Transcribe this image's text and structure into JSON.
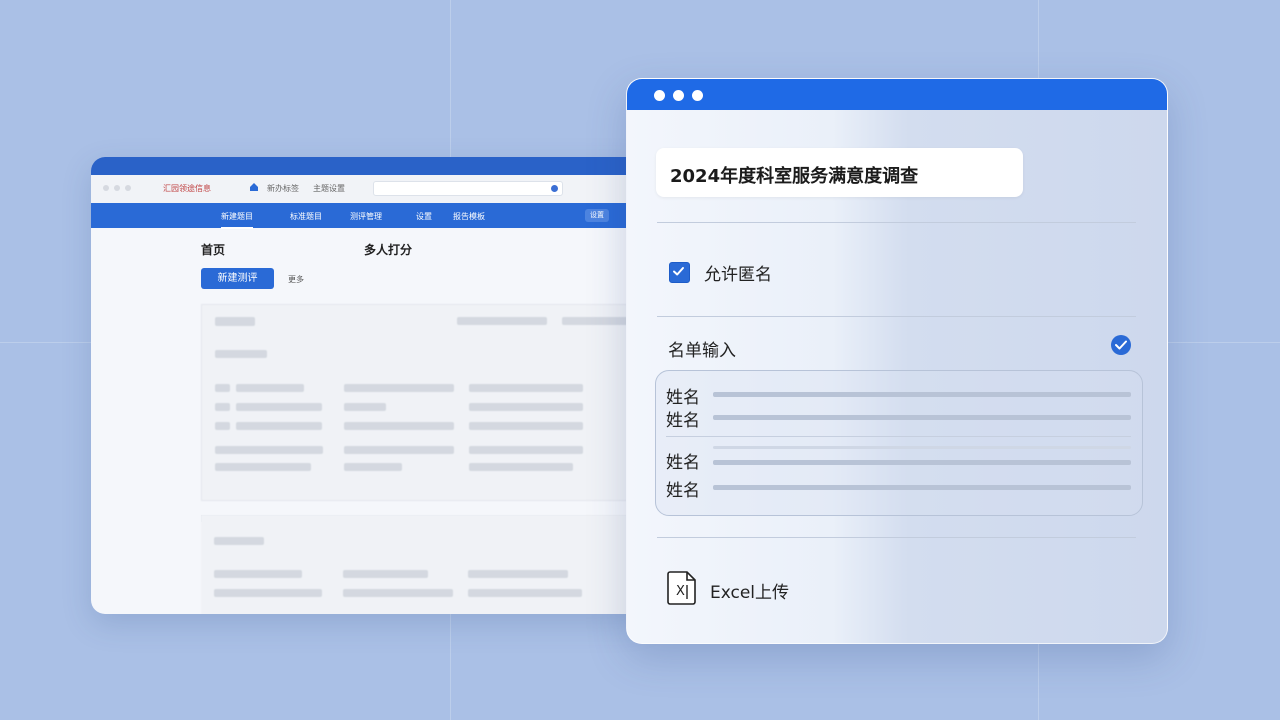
{
  "back_window": {
    "toolbar": {
      "text1": "汇园领途信息",
      "text2": "新办标签",
      "text3": "主题设置"
    },
    "nav": [
      "新建题目",
      "标准题目",
      "测评管理",
      "设置",
      "报告模板"
    ],
    "nav_button": "设置",
    "page_title": "首页",
    "multi_label": "多人打分",
    "new_button": "新建测评",
    "sub_link": "更多"
  },
  "survey_card": {
    "title": "2024年度科室服务满意度调查",
    "allow_anonymous": {
      "label": "允许匿名",
      "checked": true
    },
    "name_list": {
      "label": "名单输入",
      "enabled": true,
      "rows": [
        "姓名",
        "姓名",
        "姓名",
        "姓名"
      ]
    },
    "excel_upload": {
      "label": "Excel上传",
      "icon": "excel-file-icon"
    }
  },
  "colors": {
    "background": "#aac0e6",
    "accent": "#1f6ae6",
    "back_nav": "#2a6ad6"
  }
}
